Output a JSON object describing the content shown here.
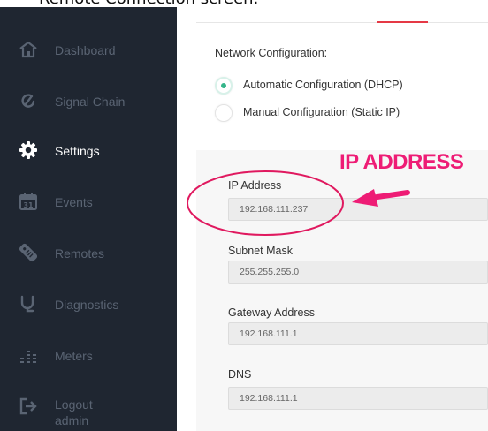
{
  "caption": {
    "text": "Remote Connection screen."
  },
  "sidebar": {
    "items": [
      {
        "label": "Dashboard",
        "icon": "home-icon",
        "active": false
      },
      {
        "label": "Signal Chain",
        "icon": "signal-chain-icon",
        "active": false
      },
      {
        "label": "Settings",
        "icon": "gear-icon",
        "active": true
      },
      {
        "label": "Events",
        "icon": "calendar-icon",
        "calendar_day": "31",
        "active": false
      },
      {
        "label": "Remotes",
        "icon": "remote-icon",
        "active": false
      },
      {
        "label": "Diagnostics",
        "icon": "stethoscope-icon",
        "active": false
      },
      {
        "label": "Meters",
        "icon": "meters-icon",
        "active": false
      },
      {
        "label": "Logout",
        "sublabel": "admin",
        "icon": "logout-icon",
        "active": false
      }
    ]
  },
  "main": {
    "network_title": "Network Configuration:",
    "options": [
      {
        "label": "Automatic Configuration (DHCP)",
        "checked": true
      },
      {
        "label": "Manual Configuration (Static IP)",
        "checked": false
      }
    ],
    "fields": [
      {
        "label": "IP Address",
        "value": "192.168.111.237"
      },
      {
        "label": "Subnet Mask",
        "value": "255.255.255.0"
      },
      {
        "label": "Gateway Address",
        "value": "192.168.111.1"
      },
      {
        "label": "DNS",
        "value": "192.168.111.1"
      }
    ]
  },
  "annotation": {
    "text": "IP ADDRESS",
    "color": "#ee1c75"
  },
  "colors": {
    "sidebar_bg": "#1f2631",
    "sidebar_text": "#5a6473",
    "active_text": "#ffffff",
    "tab_accent": "#e53945",
    "radio_accent": "#35b58a"
  }
}
